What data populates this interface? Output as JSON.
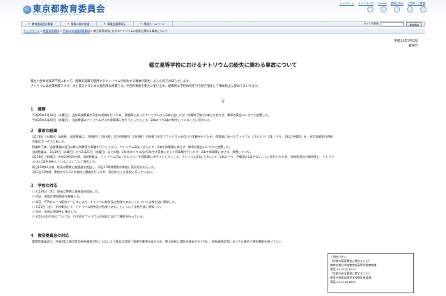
{
  "header": {
    "logo_text": "東京都教育委員会",
    "logo_sub": "Tokyo Metropolitan Board of Education",
    "top_links": [
      "トップページ",
      "サイトマップ",
      "english",
      "朗読に戻る",
      "ご意見・ご要望"
    ]
  },
  "nav": {
    "items": [
      "教育委員会の概要",
      "情報公開の推進",
      "事業会議等開示",
      "関連ホームページ"
    ],
    "search_label": "サイト内検索",
    "search_placeholder": "",
    "search_button": "検索開始"
  },
  "breadcrumb": {
    "items": [
      "トップページ",
      "報道発表資料",
      "平成26年報道発表資料"
    ],
    "current": "都立高等学校におけるナトリウムの紛失に関わる事故について"
  },
  "document": {
    "date": "平成26年3月1日",
    "org": "教育庁",
    "title": "都立高等学校におけるナトリウムの紛失に関わる事故について",
    "lead": [
      "都立小金井北高等学校において、授業の実験で使用するナトリウムが紛失する事故が発生しましたのでお知らせします。",
      "ナトリウムは金属物質ですが、水と反応するため大変危険な物質です。今回の事故を重大に受け止め、組織的な学校体制を引き続き強化して事故防止に努めてまいります。"
    ],
    "ki": "記",
    "sections": [
      {
        "heading": "１　概要",
        "lines": [
          "平成26年2月18日（火曜日）、当該高校教員が化学の実験を行うため、保管庫にあったナトリウムびん2本を出したが、授業終了後も2本とも戻さず、教卓の薬品コンテナに放置した。",
          "平成26年2月28日（金曜日）、当該教員はナトリウムびんを保管庫に戻そうとしたところ、2本のうち1本が紛失していることに気付いた。"
        ]
      },
      {
        "heading": "２　事故の経緯",
        "lines": [
          "2月18日（火曜日）当高校、当該教員は、1時間目（2年A組）及び6時間目（2年B組）の授業で化学でナトリウムを用いた実験を行うため、保管庫にあったナトリウム（びん入り）2本（うち、1本は予備用）を、化学実験室の教卓",
          "の薬品コンテナに出した。",
          "授業終了後、当該教員は翌日以降も同教室で実験を行うことから、ナトリウム25g（びん入り）2本を保管庫に戻さず、教卓の薬品コンテナに放置した。",
          "当該教員は、2月19日（水曜日）から2月21日（金曜日）までの間、2年化学クラス及び2年生大変者に対して同実験を行ったが、2本を保管庫に戻さず、放置していた。",
          "2月28日（木曜日）午前10時20分頃、当該教員は、ナトリウム25g（びん入り）を保管庫に戻そうとしたところ、ナトリウム25g（びん入り）2本のうち、予備用の1本がないことに気付いたため、同校校長及び副校長に、ナトリウ",
          "ムびん1本を紛失していることについて報告した。",
          "同日16時45分頃、校長は警察に被害届を提出し、同日17時頃警察が来校し実況見分を行った。",
          "3月1日10時頃、警視庁から3人が来校し捜査を行ったが、現在のところ発見に至っていない。"
        ]
      },
      {
        "heading": "３　学校の対応",
        "lines": [
          "○ 2月28日（木）、校長は警察に被害届を提出した。",
          "○ 同日、校長は緊急朝会を開催した。",
          "○ 同日、PTAのメール配信サービスにより、ナトリウム紛失及び危険であることについて全校生徒に周知した。",
          "○ 3月1日（金）、全校集会にて、ナトリウム紛失及び危険であることについて全校生徒に周知した。",
          "○ 同日、校長は保健所に報告した。",
          "○ 3月2日及び3日についても、引き続きナトリウムの発見に向けて捜索を行っている。"
        ]
      },
      {
        "heading": "４　教育委員会の対応",
        "lines": [
          "都教育委員会は、今後2度と薬品等の紛失事故が起こらないよう薬品の保管・管理の徹底を図るため、都立高校に通知を発出すると共に、校長連絡会等においても改めて周知徹底を図っていく。"
        ]
      }
    ],
    "contact": [
      "＜問合せ先＞",
      "【学校の管理運営に関すること】",
      "教育庁都立学校教育部高等学校教育課",
      "電話 03-5320-6743",
      "【学校の安全管理に関すること】",
      "教育庁指導部高等学校教育指導課",
      "電話 03-5320-6845"
    ]
  },
  "colors": {
    "brand_blue": "#2a62a8",
    "link_blue": "#1b4f91",
    "nav_bg": "#dfe6ee"
  }
}
